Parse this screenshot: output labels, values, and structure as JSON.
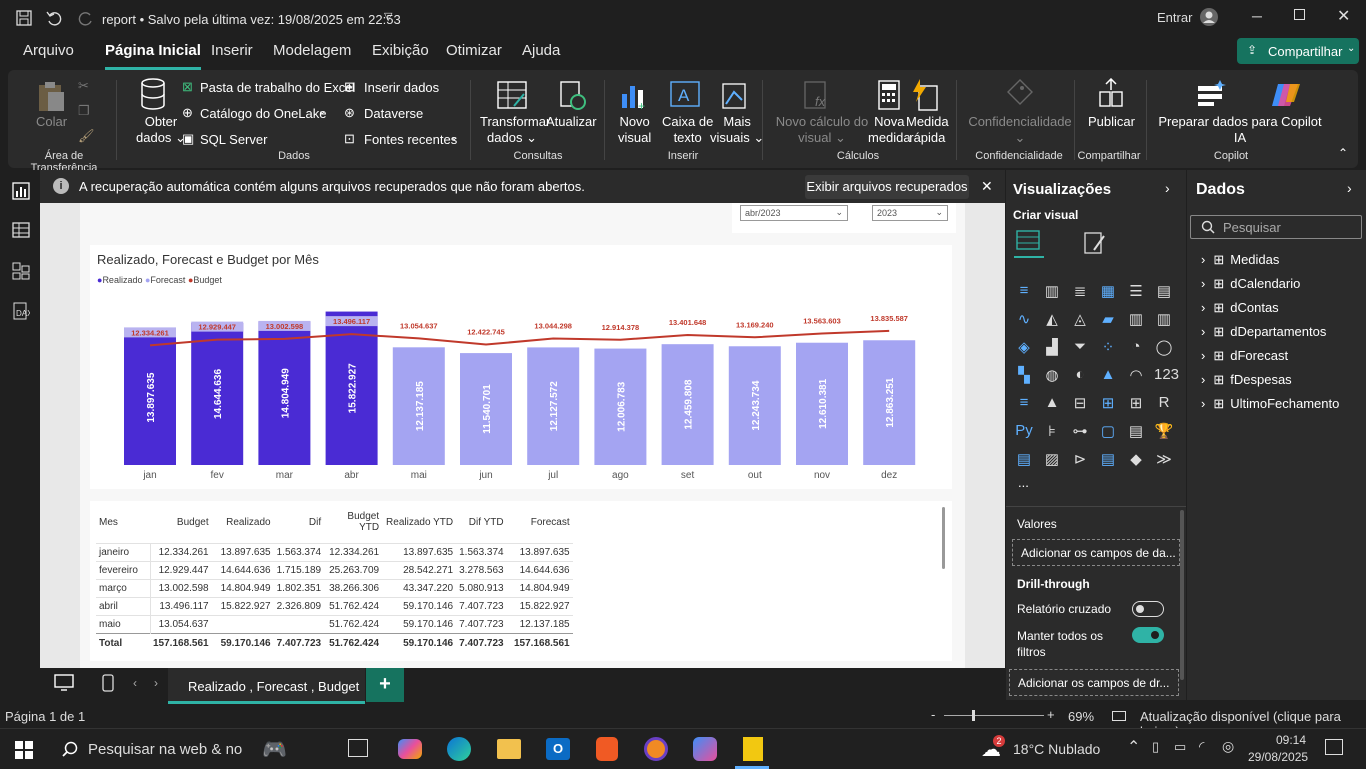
{
  "titlebar": {
    "title": "report • Salvo pela última vez: 19/08/2025 em 22:53",
    "signin": "Entrar"
  },
  "tabs": [
    "Arquivo",
    "Página Inicial",
    "Inserir",
    "Modelagem",
    "Exibição",
    "Otimizar",
    "Ajuda"
  ],
  "share": "Compartilhar",
  "ribbon": {
    "clipboard": {
      "paste": "Colar",
      "group": "Área de Transferência"
    },
    "data": {
      "get": "Obter",
      "get2": "dados",
      "excel": "Pasta de trabalho do Excel",
      "onelake": "Catálogo do OneLake",
      "sql": "SQL Server",
      "insert": "Inserir dados",
      "dataverse": "Dataverse",
      "recent": "Fontes recentes",
      "group": "Dados"
    },
    "queries": {
      "transform": "Transformar",
      "transform2": "dados",
      "refresh": "Atualizar",
      "group": "Consultas"
    },
    "insert": {
      "newvisual": "Novo",
      "newvisual2": "visual",
      "textbox": "Caixa de",
      "textbox2": "texto",
      "more": "Mais",
      "more2": "visuais",
      "group": "Inserir"
    },
    "calc": {
      "newcalc": "Novo cálculo do",
      "newcalc2": "visual",
      "newmeasure": "Nova",
      "newmeasure2": "medida",
      "quick": "Medida",
      "quick2": "rápida",
      "group": "Cálculos"
    },
    "sens": {
      "label": "Confidencialidade",
      "group": "Confidencialidade"
    },
    "sharegrp": {
      "publish": "Publicar",
      "group": "Compartilhar"
    },
    "copilot": {
      "prep": "Preparar dados para Copilot",
      "prep2": "IA",
      "group": "Copilot"
    }
  },
  "infobar": {
    "message": "A recuperação automática contém alguns arquivos recuperados que não foram abertos.",
    "button": "Exibir arquivos recuperados"
  },
  "slicers": {
    "month": "abr/2023",
    "year": "2023"
  },
  "chart_data": {
    "type": "bar",
    "title": "Realizado, Forecast e Budget por Mês",
    "legend": [
      "Realizado",
      "Forecast",
      "Budget"
    ],
    "colors": {
      "realizado": "#4a2bd4",
      "forecast": "#a4a4f2",
      "budget": "#c0392b"
    },
    "categories": [
      "jan",
      "fev",
      "mar",
      "abr",
      "mai",
      "jun",
      "jul",
      "ago",
      "set",
      "out",
      "nov",
      "dez"
    ],
    "series": [
      {
        "name": "Realizado",
        "values": [
          13897635,
          14644636,
          14804949,
          15822927,
          null,
          null,
          null,
          null,
          null,
          null,
          null,
          null
        ],
        "labels": [
          "13.897.635",
          "14.644.636",
          "14.804.949",
          "15.822.927",
          "",
          "",
          "",
          "",
          "",
          "",
          "",
          ""
        ]
      },
      {
        "name": "Forecast",
        "values": [
          null,
          null,
          null,
          null,
          12137185,
          11540701,
          12127572,
          12006783,
          12459808,
          12243734,
          12610381,
          12863251
        ],
        "labels": [
          "",
          "",
          "",
          "",
          "12.137.185",
          "11.540.701",
          "12.127.572",
          "12.006.783",
          "12.459.808",
          "12.243.734",
          "12.610.381",
          "12.863.251"
        ]
      },
      {
        "name": "Budget",
        "values": [
          12334261,
          12929447,
          13002598,
          13496117,
          13054637,
          12422745,
          13044298,
          12914378,
          13401648,
          13169240,
          13563603,
          13835587
        ],
        "labels": [
          "12.334.261",
          "12.929.447",
          "13.002.598",
          "13.496.117",
          "13.054.637",
          "12.422.745",
          "13.044.298",
          "12.914.378",
          "13.401.648",
          "13.169.240",
          "13.563.603",
          "13.835.587"
        ]
      }
    ]
  },
  "table": {
    "headers": [
      "Mes",
      "Budget",
      "Realizado",
      "Dif",
      "Budget YTD",
      "Realizado YTD",
      "Dif YTD",
      "Forecast"
    ],
    "rows": [
      [
        "janeiro",
        "12.334.261",
        "13.897.635",
        "1.563.374",
        "12.334.261",
        "13.897.635",
        "1.563.374",
        "13.897.635"
      ],
      [
        "fevereiro",
        "12.929.447",
        "14.644.636",
        "1.715.189",
        "25.263.709",
        "28.542.271",
        "3.278.563",
        "14.644.636"
      ],
      [
        "março",
        "13.002.598",
        "14.804.949",
        "1.802.351",
        "38.266.306",
        "43.347.220",
        "5.080.913",
        "14.804.949"
      ],
      [
        "abril",
        "13.496.117",
        "15.822.927",
        "2.326.809",
        "51.762.424",
        "59.170.146",
        "7.407.723",
        "15.822.927"
      ],
      [
        "maio",
        "13.054.637",
        "",
        "",
        "51.762.424",
        "59.170.146",
        "7.407.723",
        "12.137.185"
      ]
    ],
    "total": [
      "Total",
      "157.168.561",
      "59.170.146",
      "7.407.723",
      "51.762.424",
      "59.170.146",
      "7.407.723",
      "157.168.561"
    ]
  },
  "viz": {
    "title": "Visualizações",
    "create": "Criar visual",
    "values": "Valores",
    "add_fields": "Adicionar os campos de da...",
    "drill": "Drill-through",
    "cross": "Relatório cruzado",
    "keep": "Manter todos os",
    "keep2": "filtros",
    "add_drill": "Adicionar os campos de dr...",
    "more": "..."
  },
  "data_panel": {
    "title": "Dados",
    "search": "Pesquisar",
    "fields": [
      "Medidas",
      "dCalendario",
      "dContas",
      "dDepartamentos",
      "dForecast",
      "fDespesas",
      "UltimoFechamento"
    ]
  },
  "pagetab": "Realizado , Forecast , Budget",
  "status": {
    "page": "Página 1 de 1",
    "zoom": "69%",
    "update": "Atualização disponível (clique para baixar)"
  },
  "taskbar": {
    "search": "Pesquisar na web & no",
    "weather": "18°C  Nublado",
    "time": "09:14",
    "date": "29/08/2025",
    "badge": "2"
  }
}
